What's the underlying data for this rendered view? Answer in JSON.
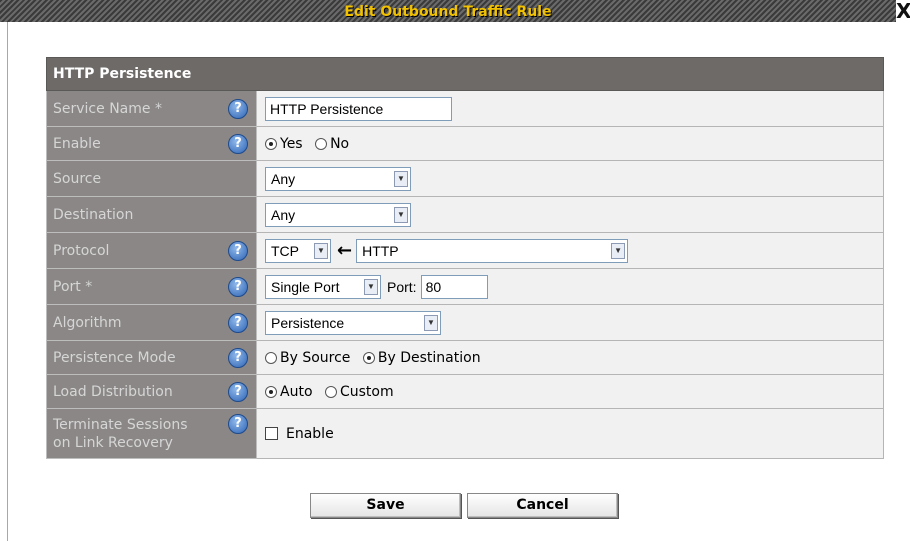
{
  "dialog": {
    "title": "Edit Outbound Traffic Rule",
    "close_label": "X"
  },
  "section": {
    "title": "HTTP Persistence"
  },
  "fields": {
    "service_name": {
      "label": "Service Name *",
      "value": "HTTP Persistence"
    },
    "enable": {
      "label": "Enable",
      "options": [
        "Yes",
        "No"
      ],
      "selected": "Yes"
    },
    "source": {
      "label": "Source",
      "value": "Any"
    },
    "destination": {
      "label": "Destination",
      "value": "Any"
    },
    "protocol": {
      "label": "Protocol",
      "value": "TCP",
      "service": "HTTP"
    },
    "port": {
      "label": "Port *",
      "mode": "Single Port",
      "port_label": "Port:",
      "port_value": "80"
    },
    "algorithm": {
      "label": "Algorithm",
      "value": "Persistence"
    },
    "persistence_mode": {
      "label": "Persistence Mode",
      "options": [
        "By Source",
        "By Destination"
      ],
      "selected": "By Destination"
    },
    "load_distribution": {
      "label": "Load Distribution",
      "options": [
        "Auto",
        "Custom"
      ],
      "selected": "Auto"
    },
    "terminate_sessions": {
      "label_line1": "Terminate Sessions",
      "label_line2": "on Link Recovery",
      "checkbox_label": "Enable",
      "checked": false
    }
  },
  "buttons": {
    "save": "Save",
    "cancel": "Cancel"
  },
  "icons": {
    "help": "help-icon",
    "close": "close-icon",
    "dropdown": "chevron-down-icon",
    "arrow": "arrow-left-icon"
  },
  "colors": {
    "title_text": "#f2c200",
    "header_bg": "#6e6a68",
    "label_bg": "#8a8786",
    "value_bg": "#f1f1f1",
    "help_icon": "#2f64b4"
  }
}
